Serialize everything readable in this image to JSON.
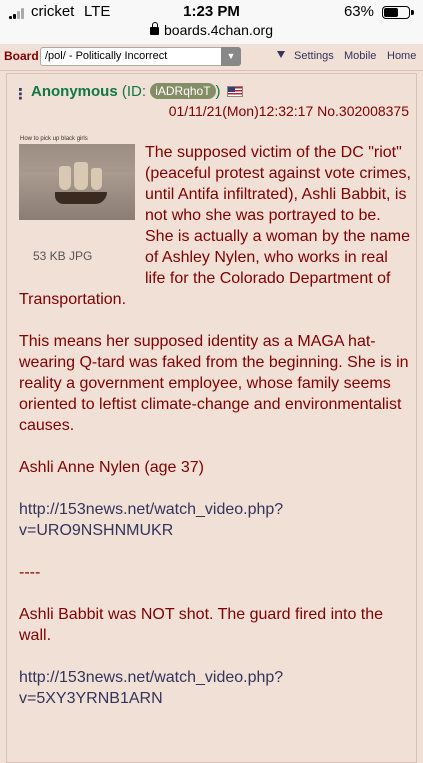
{
  "status_bar": {
    "carrier": "cricket",
    "network": "LTE",
    "time": "1:23 PM",
    "battery": "63%",
    "battery_level": 0.63,
    "url": "boards.4chan.org"
  },
  "board_nav": {
    "label": "Board",
    "selected_board": "/pol/ - Politically Incorrect",
    "links": [
      "Settings",
      "Mobile",
      "Home"
    ]
  },
  "post": {
    "name": "Anonymous",
    "id_prefix": "(ID: ",
    "id": "iADRqhoT",
    "id_suffix": ")",
    "datetime": "01/11/21(Mon)12:32:17 No.302008375",
    "thumbnail_caption": "How to pick up black girls",
    "file_info": "53 KB JPG",
    "paragraphs": [
      "The supposed victim of the DC \"riot\" (peaceful protest against vote crimes, until Antifa infiltrated), Ashli Babbit, is not who she was portrayed to be. She is actually a woman by the name of Ashley Nylen, who works in real life for the Colorado Department of Transportation.",
      "This means her supposed identity as a MAGA hat-wearing Q-tard was faked from the beginning. She is in reality a government employee, whose family seems oriented to leftist climate-change and environmentalist causes.",
      "Ashli Anne Nylen (age 37)"
    ],
    "link1": "http://153news.net/watch_video.php?v=URO9NSHNMUKR",
    "separator": "----",
    "paragraph_after": "Ashli Babbit was NOT shot. The guard fired into the wall.",
    "link2": "http://153news.net/watch_video.php?v=5XY3YRNB1ARN"
  },
  "colors": {
    "background": "#f0e0d6",
    "post_text": "#800000",
    "name": "#117743",
    "link": "#34345c",
    "id_pill": "#838d66"
  }
}
